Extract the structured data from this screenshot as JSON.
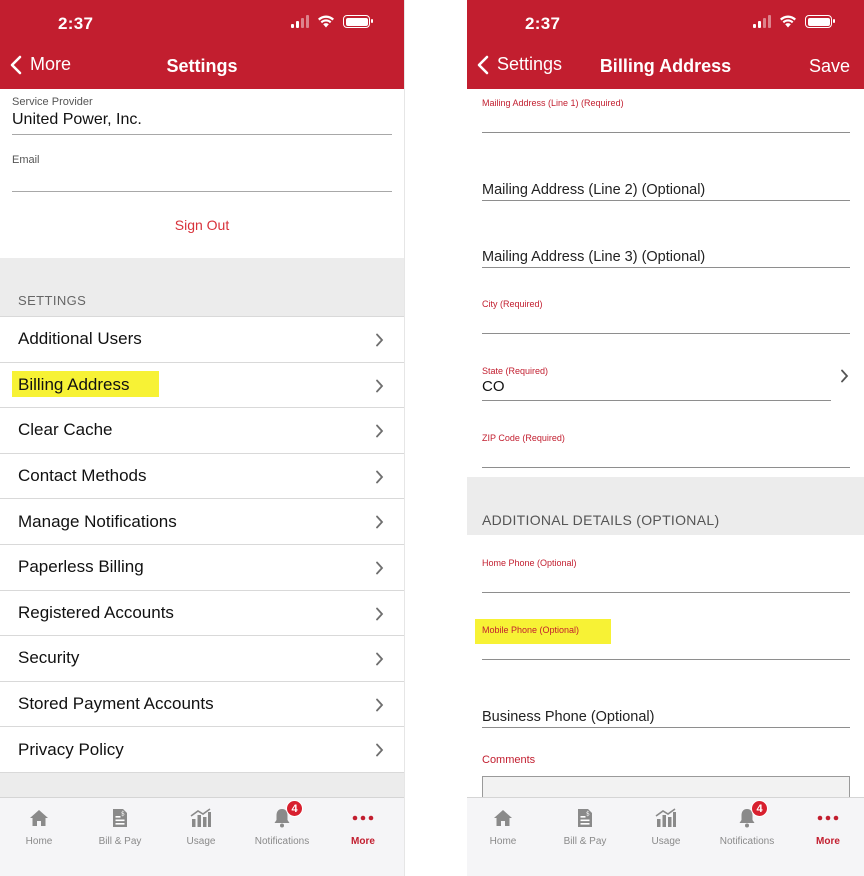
{
  "status": {
    "time": "2:37"
  },
  "left": {
    "nav": {
      "back_label": "More",
      "title": "Settings"
    },
    "service_provider": {
      "label": "Service Provider",
      "value": "United Power, Inc."
    },
    "email": {
      "label": "Email",
      "value": ""
    },
    "sign_out": "Sign Out",
    "section_header": "SETTINGS",
    "items": [
      {
        "label": "Additional Users"
      },
      {
        "label": "Billing Address",
        "highlighted": true
      },
      {
        "label": "Clear Cache"
      },
      {
        "label": "Contact Methods"
      },
      {
        "label": "Manage Notifications"
      },
      {
        "label": "Paperless Billing"
      },
      {
        "label": "Registered Accounts"
      },
      {
        "label": "Security"
      },
      {
        "label": "Stored Payment Accounts"
      },
      {
        "label": "Privacy Policy"
      }
    ]
  },
  "right": {
    "nav": {
      "back_label": "Settings",
      "title": "Billing Address",
      "action": "Save"
    },
    "fields": {
      "mailing1": {
        "label": "Mailing Address (Line 1) (Required)",
        "value": ""
      },
      "mailing2": {
        "placeholder": "Mailing Address (Line 2) (Optional)"
      },
      "mailing3": {
        "placeholder": "Mailing Address (Line 3) (Optional)"
      },
      "city": {
        "label": "City (Required)",
        "value": ""
      },
      "state": {
        "label": "State (Required)",
        "value": "CO"
      },
      "zip": {
        "label": "ZIP Code (Required)",
        "value": ""
      }
    },
    "additional_header": "ADDITIONAL DETAILS (OPTIONAL)",
    "additional": {
      "home_phone": {
        "label": "Home Phone (Optional)",
        "value": ""
      },
      "mobile_phone": {
        "label": "Mobile Phone (Optional)",
        "value": "",
        "highlighted": true
      },
      "business_phone": {
        "placeholder": "Business Phone (Optional)"
      }
    },
    "comments_label": "Comments"
  },
  "tabbar": {
    "tabs": [
      {
        "label": "Home",
        "icon": "home-icon"
      },
      {
        "label": "Bill & Pay",
        "icon": "bill-icon"
      },
      {
        "label": "Usage",
        "icon": "usage-chart-icon"
      },
      {
        "label": "Notifications",
        "icon": "bell-icon",
        "badge": "4"
      },
      {
        "label": "More",
        "icon": "more-dots-icon",
        "active": true
      }
    ]
  },
  "colors": {
    "brand": "#c21e2f",
    "highlight": "#f7f235",
    "link": "#d8323b"
  }
}
